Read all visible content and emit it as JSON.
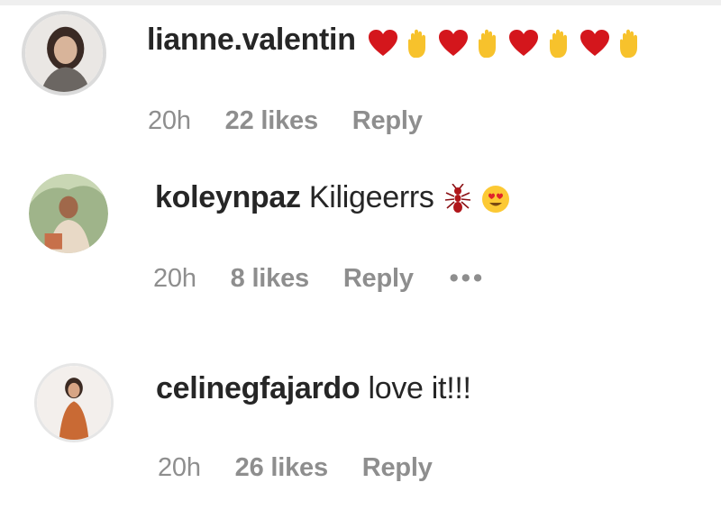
{
  "comments": [
    {
      "username": "lianne.valentin",
      "text": "",
      "emojis": [
        "red-heart",
        "clapping-hand",
        "red-heart",
        "clapping-hand",
        "red-heart",
        "clapping-hand",
        "red-heart",
        "clapping-hand"
      ],
      "time": "20h",
      "likes": "22 likes",
      "reply": "Reply",
      "more": ""
    },
    {
      "username": "koleynpaz",
      "text": "Kiligeerrs",
      "emojis": [
        "ant",
        "smiling-face-with-heart-eyes"
      ],
      "time": "20h",
      "likes": "8 likes",
      "reply": "Reply",
      "more": "•••"
    },
    {
      "username": "celinegfajardo",
      "text": "love it!!!",
      "emojis": [],
      "time": "20h",
      "likes": "26 likes",
      "reply": "Reply",
      "more": ""
    }
  ],
  "colors": {
    "username": "#262626",
    "meta": "#8e8e8e",
    "heart": "#d4161c",
    "hand": "#f7c22c"
  }
}
